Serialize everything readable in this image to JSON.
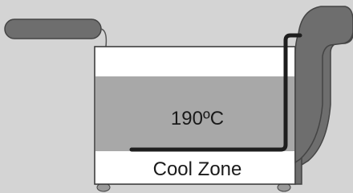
{
  "diagram": {
    "oil_temperature_label": "190ºC",
    "cool_zone_label": "Cool Zone"
  },
  "colors": {
    "background": "#d4d4d4",
    "oil": "#a8a8a8",
    "tank_fill": "#ffffff",
    "outline": "#333333",
    "handle": "#6e6e6e",
    "element": "#1e1e1e",
    "foot": "#9a9a9a"
  }
}
